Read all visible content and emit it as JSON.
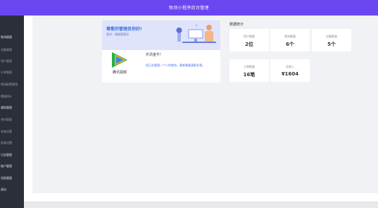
{
  "header": {
    "title": "牧场小程序后台管理"
  },
  "sidebar": {
    "items": [
      {
        "label": "牧场管理"
      },
      {
        "label": "设备管理"
      },
      {
        "label": "用户管理"
      },
      {
        "label": "订单管理"
      },
      {
        "label": "牧场配置管理"
      },
      {
        "label": "数据统计"
      },
      {
        "label": "通知管理"
      },
      {
        "label": "合约管理"
      },
      {
        "label": "系统设置"
      },
      {
        "label": "权限设置"
      },
      {
        "label": "日志管理"
      },
      {
        "label": "账户管理"
      },
      {
        "label": "消息管理"
      },
      {
        "label": "退出"
      }
    ]
  },
  "welcome": {
    "title": "尊敬的管理员你好!",
    "role": "身份：超级管理员",
    "org_name": "乐讯金牛!",
    "org_desc": "您正在管理一个人的牧场，更新需要请联系我。",
    "logo_text": "腾讯视频"
  },
  "stats": {
    "title": "数据统计",
    "cards": [
      {
        "label": "用户数量",
        "value": "2位"
      },
      {
        "label": "牧场数量",
        "value": "6个"
      },
      {
        "label": "设备数量",
        "value": "5个"
      },
      {
        "label": "订单数量",
        "value": "16笔"
      },
      {
        "label": "总收入",
        "value": "¥1604"
      }
    ]
  },
  "colors": {
    "header": "#6a46f0",
    "sidebar": "#2b2f3a",
    "accent": "#3f6de0"
  }
}
